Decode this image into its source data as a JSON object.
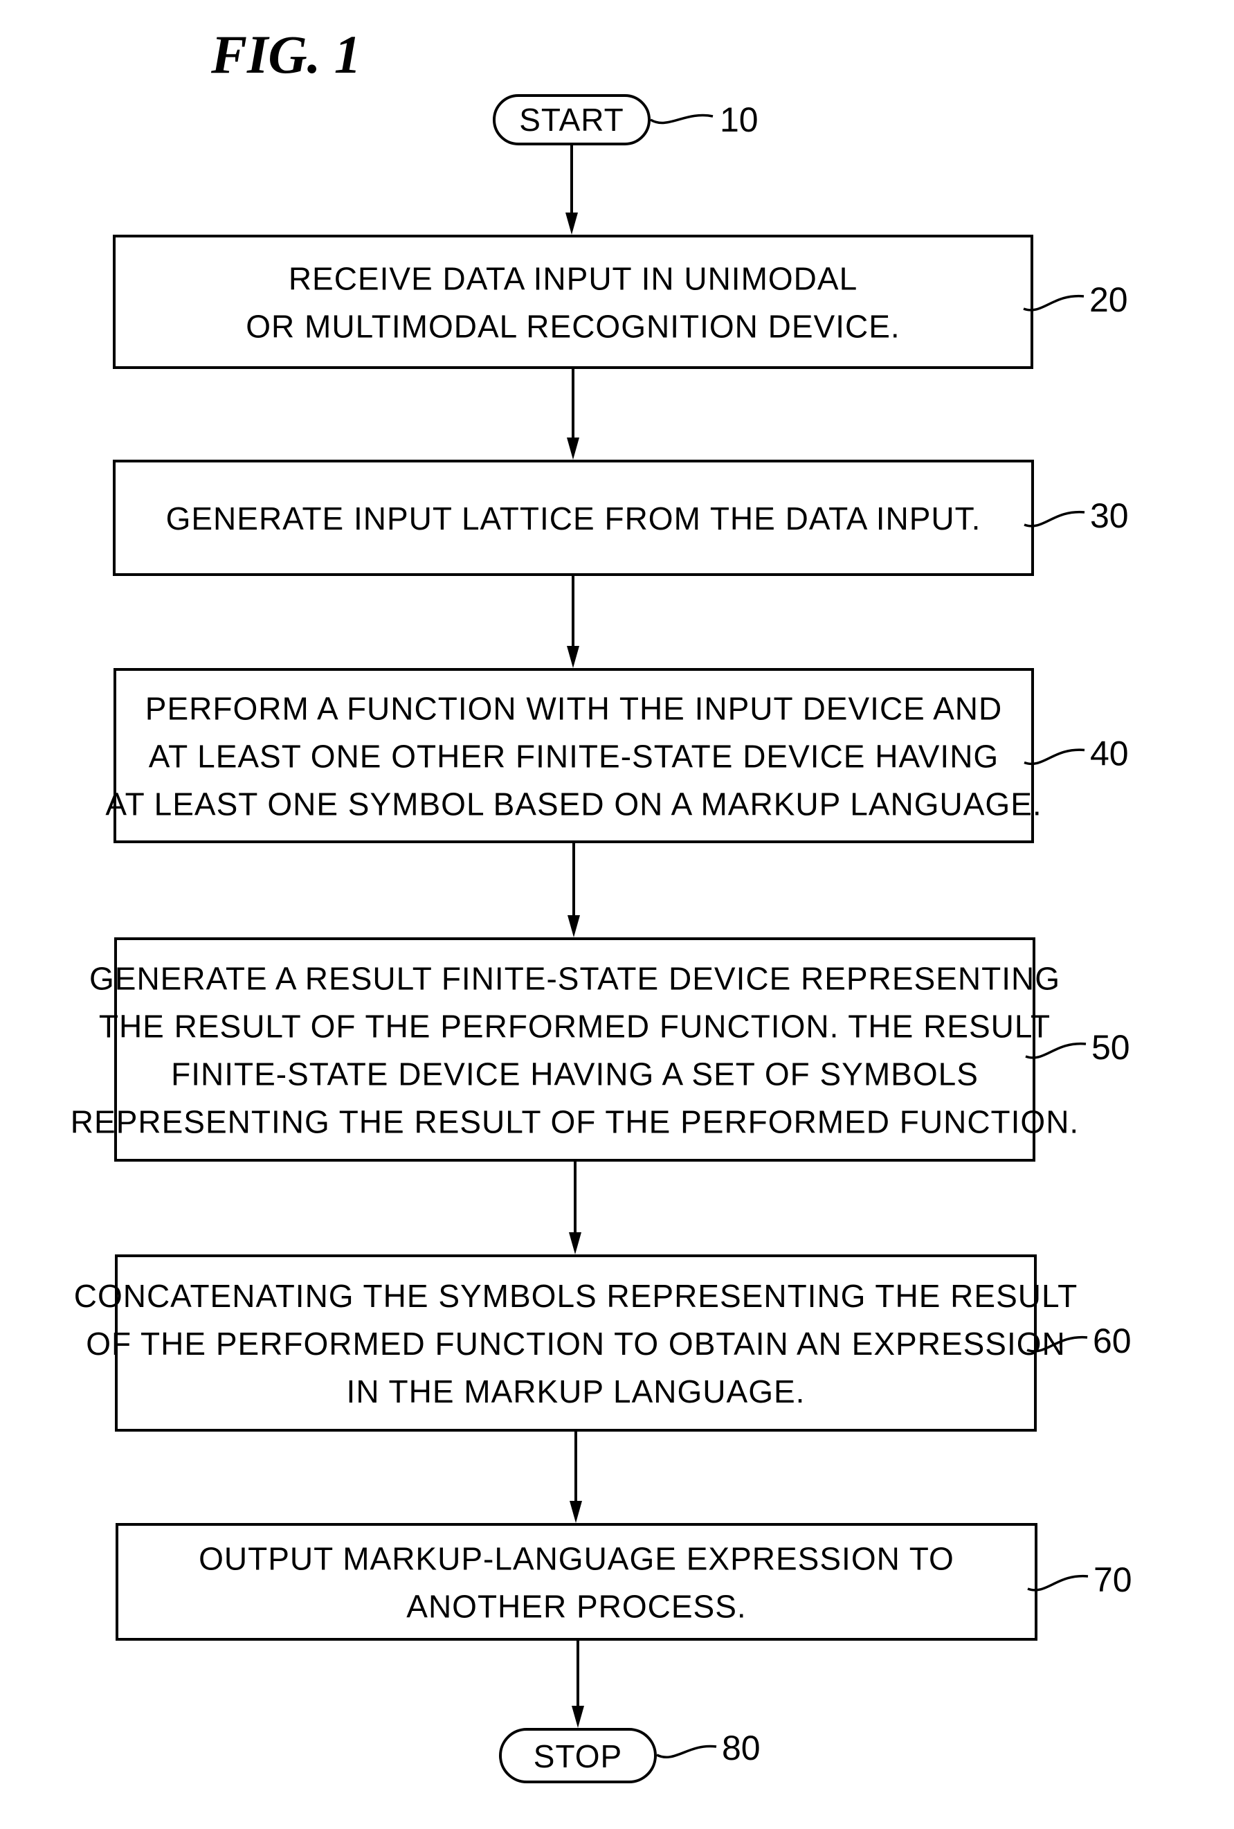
{
  "figure": {
    "title": "FIG. 1",
    "start": {
      "label": "START",
      "ref": "10"
    },
    "stop": {
      "label": "STOP",
      "ref": "80"
    },
    "steps": [
      {
        "ref": "20",
        "lines": [
          "RECEIVE DATA INPUT IN UNIMODAL",
          "OR MULTIMODAL RECOGNITION DEVICE."
        ]
      },
      {
        "ref": "30",
        "lines": [
          "GENERATE INPUT LATTICE FROM THE DATA INPUT."
        ]
      },
      {
        "ref": "40",
        "lines": [
          "PERFORM A FUNCTION WITH THE INPUT DEVICE AND",
          "AT LEAST ONE OTHER FINITE-STATE DEVICE HAVING",
          "AT LEAST ONE SYMBOL BASED ON A MARKUP LANGUAGE."
        ]
      },
      {
        "ref": "50",
        "lines": [
          "GENERATE A RESULT FINITE-STATE DEVICE REPRESENTING",
          "THE RESULT OF THE PERFORMED FUNCTION. THE RESULT",
          "FINITE-STATE DEVICE HAVING A SET OF SYMBOLS",
          "REPRESENTING THE RESULT OF THE PERFORMED FUNCTION."
        ]
      },
      {
        "ref": "60",
        "lines": [
          "CONCATENATING THE SYMBOLS REPRESENTING THE RESULT",
          "OF THE PERFORMED FUNCTION TO OBTAIN AN EXPRESSION",
          "IN THE MARKUP LANGUAGE."
        ]
      },
      {
        "ref": "70",
        "lines": [
          "OUTPUT MARKUP-LANGUAGE EXPRESSION TO",
          "ANOTHER PROCESS."
        ]
      }
    ]
  }
}
